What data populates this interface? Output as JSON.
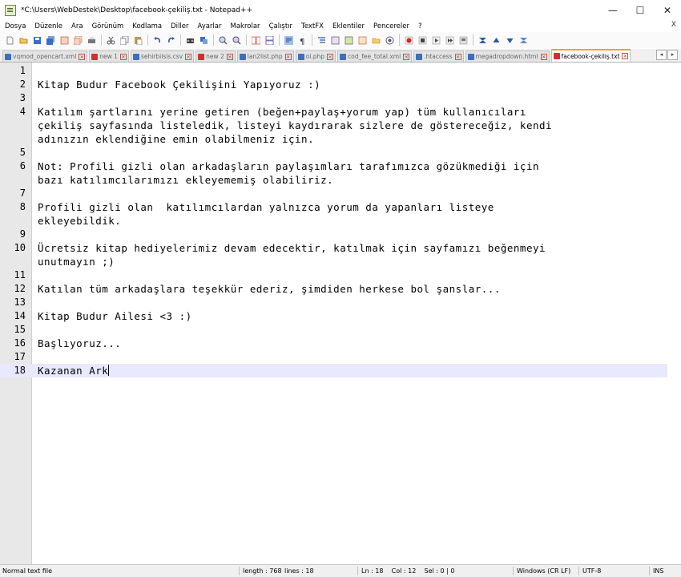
{
  "window": {
    "title": "*C:\\Users\\WebDestek\\Desktop\\facebook-çekiliş.txt - Notepad++",
    "minimize": "—",
    "maximize": "☐",
    "close": "✕"
  },
  "menu": {
    "items": [
      "Dosya",
      "Düzenle",
      "Ara",
      "Görünüm",
      "Kodlama",
      "Diller",
      "Ayarlar",
      "Makrolar",
      "Çalıştır",
      "TextFX",
      "Eklentiler",
      "Pencereler",
      "?"
    ],
    "close": "X"
  },
  "toolbar": {
    "icons": [
      "new-file-icon",
      "open-file-icon",
      "save-icon",
      "save-all-icon",
      "close-icon",
      "close-all-icon",
      "print-icon",
      "cut-icon",
      "copy-icon",
      "paste-icon",
      "undo-icon",
      "redo-icon",
      "find-icon",
      "replace-icon",
      "zoom-in-icon",
      "zoom-out-icon",
      "sync-vertical-icon",
      "sync-horizontal-icon",
      "word-wrap-icon",
      "show-all-chars-icon",
      "indent-guide-icon",
      "udl-icon",
      "doc-map-icon",
      "function-list-icon",
      "folder-workspace-icon",
      "monitoring-icon",
      "record-macro-icon",
      "stop-record-icon",
      "play-macro-icon",
      "play-multiple-icon",
      "save-macro-icon",
      "textfx-icon-1",
      "textfx-icon-2",
      "textfx-icon-3",
      "textfx-icon-4"
    ]
  },
  "tabs": [
    {
      "label": "vqmod_opencart.xml",
      "unsaved": false
    },
    {
      "label": "new 1",
      "unsaved": true
    },
    {
      "label": "sehirbilsis.csv",
      "unsaved": false
    },
    {
      "label": "new 2",
      "unsaved": true
    },
    {
      "label": "lan2list.php",
      "unsaved": false
    },
    {
      "label": "ol.php",
      "unsaved": false
    },
    {
      "label": "cod_fee_total.xml",
      "unsaved": false
    },
    {
      "label": ".htaccess",
      "unsaved": false
    },
    {
      "label": "megadropdown.html",
      "unsaved": false
    },
    {
      "label": "facebook-çekiliş.txt",
      "unsaved": true,
      "active": true
    }
  ],
  "editor": {
    "lines": [
      {
        "num": "1",
        "text": ""
      },
      {
        "num": "2",
        "text": "Kitap Budur Facebook Çekilişini Yapıyoruz :)"
      },
      {
        "num": "3",
        "text": ""
      },
      {
        "num": "4",
        "text": "Katılım şartlarını yerine getiren (beğen+paylaş+yorum yap) tüm kullanıcıları"
      },
      {
        "num": "",
        "text": "çekiliş sayfasında listeledik, listeyi kaydırarak sizlere de göstereceğiz, kendi"
      },
      {
        "num": "",
        "text": "adınızın eklendiğine emin olabilmeniz için."
      },
      {
        "num": "5",
        "text": ""
      },
      {
        "num": "6",
        "text": "Not: Profili gizli olan arkadaşların paylaşımları tarafımızca gözükmediği için"
      },
      {
        "num": "",
        "text": "bazı katılımcılarımızı ekleyememiş olabiliriz."
      },
      {
        "num": "7",
        "text": ""
      },
      {
        "num": "8",
        "text": "Profili gizli olan  katılımcılardan yalnızca yorum da yapanları listeye"
      },
      {
        "num": "",
        "text": "ekleyebildik."
      },
      {
        "num": "9",
        "text": ""
      },
      {
        "num": "10",
        "text": "Ücretsiz kitap hediyelerimiz devam edecektir, katılmak için sayfamızı beğenmeyi"
      },
      {
        "num": "",
        "text": "unutmayın ;)"
      },
      {
        "num": "11",
        "text": ""
      },
      {
        "num": "12",
        "text": "Katılan tüm arkadaşlara teşekkür ederiz, şimdiden herkese bol şanslar..."
      },
      {
        "num": "13",
        "text": ""
      },
      {
        "num": "14",
        "text": "Kitap Budur Ailesi <3 :)"
      },
      {
        "num": "15",
        "text": ""
      },
      {
        "num": "16",
        "text": "Başlıyoruz..."
      },
      {
        "num": "17",
        "text": ""
      },
      {
        "num": "18",
        "text": "Kazanan Ark",
        "current": true
      }
    ]
  },
  "status": {
    "file_type": "Normal text file",
    "length": "length : 768",
    "lines": "lines : 18",
    "position": "Ln : 18    Col : 12    Sel : 0 | 0",
    "eol": "Windows (CR LF)",
    "encoding": "UTF-8",
    "mode": "INS"
  }
}
